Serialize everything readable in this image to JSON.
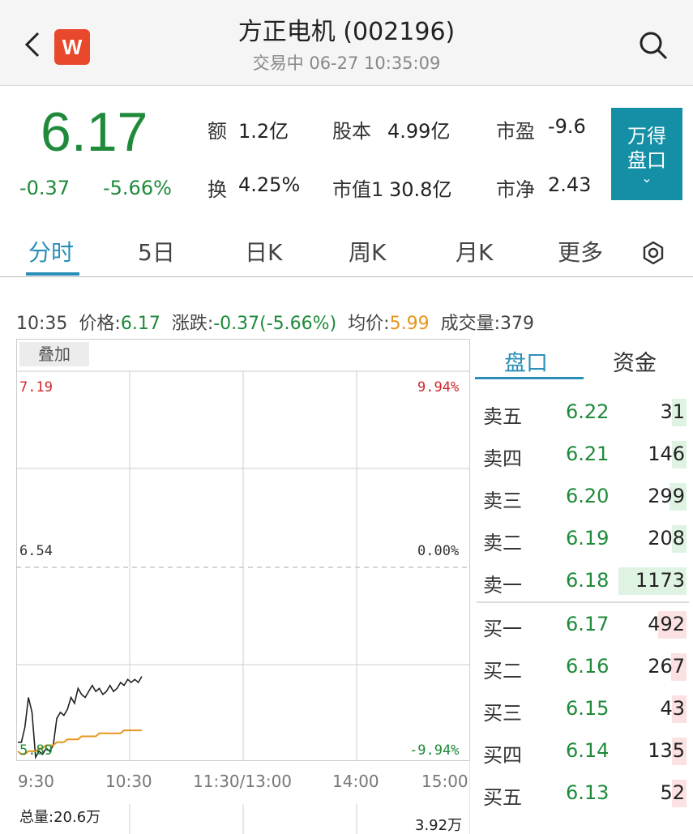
{
  "header": {
    "title": "方正电机 (002196)",
    "subtitle": "交易中 06-27 10:35:09",
    "logo_letter": "W",
    "back_icon": "chevron-left-icon",
    "search_icon": "search-icon"
  },
  "quote": {
    "price": "6.17",
    "change": "-0.37",
    "change_pct": "-5.66%",
    "stats": [
      {
        "label": "额",
        "value": "1.2亿"
      },
      {
        "label": "股本",
        "value": "4.99亿"
      },
      {
        "label": "市盈",
        "value": "-9.6"
      },
      {
        "label": "换",
        "value": "4.25%"
      },
      {
        "label": "市值1",
        "value": "30.8亿"
      },
      {
        "label": "市净",
        "value": "2.43"
      }
    ],
    "wind_button": {
      "line1": "万得",
      "line2": "盘口",
      "chevron": "⌄"
    }
  },
  "tabs": [
    "分时",
    "5日",
    "日K",
    "周K",
    "月K",
    "更多"
  ],
  "tabs_active": "分时",
  "info": {
    "time": "10:35",
    "price_label": "价格:",
    "price": "6.17",
    "change_label": "涨跌:",
    "change": "-0.37(-5.66%)",
    "avg_label": "均价:",
    "avg": "5.99",
    "volume_label": "成交量:",
    "volume": "379"
  },
  "chart": {
    "overlay_button": "叠加",
    "y_high": "7.19",
    "y_mid": "6.54",
    "y_low": "5.89",
    "pct_high": "9.94%",
    "pct_mid": "0.00%",
    "pct_low": "-9.94%",
    "time_labels": [
      "9:30",
      "10:30",
      "11:30/13:00",
      "14:00",
      "15:00"
    ],
    "total_volume": "总量:20.6万",
    "vol_max": "3.92万",
    "colors": {
      "price_line": "#222222",
      "avg_line": "#e8961c",
      "up": "#d0282e",
      "down": "#1e8a3a"
    }
  },
  "chart_data": {
    "type": "line",
    "title": "",
    "xlabel": "",
    "ylabel": "",
    "ylim": [
      5.89,
      7.19
    ],
    "x_range": [
      "9:30",
      "15:00"
    ],
    "series": [
      {
        "values": [
          5.95,
          5.95,
          6.0,
          6.1,
          6.05,
          5.9,
          5.92,
          5.91,
          5.93,
          5.92,
          5.94,
          6.03,
          6.05,
          6.04,
          6.06,
          6.1,
          6.08,
          6.13,
          6.11,
          6.1,
          6.12,
          6.14,
          6.12,
          6.13,
          6.11,
          6.12,
          6.14,
          6.12,
          6.13,
          6.15,
          6.14,
          6.16,
          6.15,
          6.16,
          6.15,
          6.17
        ],
        "color": "#222222"
      },
      {
        "values": [
          5.92,
          5.91,
          5.91,
          5.92,
          5.92,
          5.92,
          5.93,
          5.93,
          5.94,
          5.94,
          5.94,
          5.95,
          5.95,
          5.95,
          5.96,
          5.96,
          5.96,
          5.96,
          5.97,
          5.97,
          5.97,
          5.97,
          5.97,
          5.98,
          5.98,
          5.98,
          5.98,
          5.98,
          5.98,
          5.98,
          5.99,
          5.99,
          5.99,
          5.99,
          5.99,
          5.99
        ],
        "color": "#e8961c"
      }
    ]
  },
  "orderbook": {
    "tabs": [
      "盘口",
      "资金"
    ],
    "asks": [
      {
        "name": "卖五",
        "price": "6.22",
        "volume": "31"
      },
      {
        "name": "卖四",
        "price": "6.21",
        "volume": "146"
      },
      {
        "name": "卖三",
        "price": "6.20",
        "volume": "299"
      },
      {
        "name": "卖二",
        "price": "6.19",
        "volume": "208"
      },
      {
        "name": "卖一",
        "price": "6.18",
        "volume": "1173"
      }
    ],
    "bids": [
      {
        "name": "买一",
        "price": "6.17",
        "volume": "492"
      },
      {
        "name": "买二",
        "price": "6.16",
        "volume": "267"
      },
      {
        "name": "买三",
        "price": "6.15",
        "volume": "43"
      },
      {
        "name": "买四",
        "price": "6.14",
        "volume": "135"
      },
      {
        "name": "买五",
        "price": "6.13",
        "volume": "52"
      }
    ],
    "ask_bar_color": "#dff3e3",
    "bid_bar_color": "#fbe1e1"
  }
}
